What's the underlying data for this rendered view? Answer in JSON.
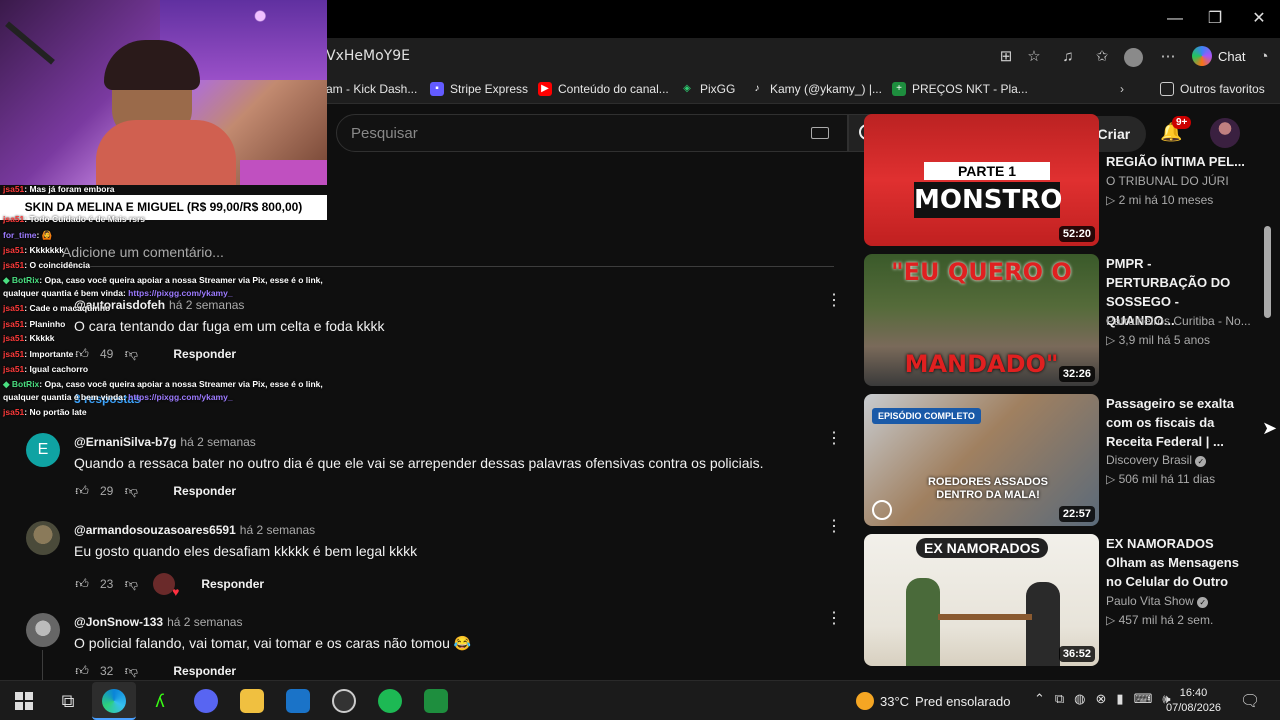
{
  "browser": {
    "url": "VxHeMoY9E",
    "chat_label": "Chat",
    "bookmarks": [
      {
        "label": "am - Kick Dash..."
      },
      {
        "label": "Stripe Express"
      },
      {
        "label": "Conteúdo do canal..."
      },
      {
        "label": "PixGG"
      },
      {
        "label": "Kamy (@ykamy_) |..."
      },
      {
        "label": "PREÇOS NKT - Pla..."
      }
    ],
    "other_favorites": "Outros favoritos"
  },
  "youtube": {
    "search_placeholder": "Pesquisar",
    "create_label": "Criar",
    "notif_badge": "9+",
    "add_comment": "Adicione um comentário...",
    "replies_label": "3 respostas",
    "reply_label": "Responder",
    "comments": [
      {
        "handle": "@autoraisdofeh",
        "time": "há 2 semanas",
        "text": "O cara tentando dar fuga em um celta e foda kkkk",
        "likes": "49"
      },
      {
        "handle": "@ErnaniSilva-b7g",
        "time": "há 2 semanas",
        "text": "Quando a ressaca bater no outro dia é que ele vai se arrepender dessas palavras ofensivas contra os policiais.",
        "likes": "29",
        "avatar_letter": "E"
      },
      {
        "handle": "@armandosouzasoares6591",
        "time": "há 2 semanas",
        "text": "Eu gosto quando eles desafiam kkkkk é bem legal kkkk",
        "likes": "23"
      },
      {
        "handle": "@JonSnow-133",
        "time": "há 2 semanas",
        "text": "O policial falando, vai tomar, vai tomar e os caras não tomou 😂",
        "likes": "32"
      }
    ],
    "videos": [
      {
        "title": "REGIÃO ÍNTIMA PEL...",
        "channel": "O TRIBUNAL DO JÚRI",
        "meta": "▷ 2 mi  há 10 meses",
        "duration": "52:20",
        "thumb_text": "PARTE 1\nMONSTRO"
      },
      {
        "title": "PMPR - PERTURBAÇÃO DO SOSSEGO - QUANDO...",
        "channel": "Patrulheiros Curitiba - No...",
        "meta": "▷ 3,9 mil  há 5 anos",
        "duration": "32:26",
        "thumb_text_top": "\"EU QUERO O",
        "thumb_text_bottom": "MANDADO\""
      },
      {
        "title": "Passageiro se exalta com os fiscais da Receita Federal | ...",
        "channel": "Discovery Brasil",
        "meta": "▷ 506 mil  há 11 dias",
        "duration": "22:57",
        "badge": "EPISÓDIO COMPLETO",
        "thumb_caption": "ROEDORES ASSADOS DENTRO DA MALA!"
      },
      {
        "title": "EX NAMORADOS Olham as Mensagens no Celular do Outro",
        "channel": "Paulo Vita Show",
        "meta": "▷ 457 mil  há 2 sem.",
        "duration": "36:52",
        "thumb_text": "EX NAMORADOS"
      }
    ]
  },
  "stream_overlay": {
    "skin_banner": "SKIN DA MELINA E MIGUEL (R$ 99,00/R$ 800,00)",
    "chat": [
      {
        "user": "jsa51",
        "msg": ": Mas já foram embora"
      },
      {
        "user": "jsa51",
        "msg": ": Todo Cuidado é de Mais rsrs"
      },
      {
        "user": "for_time",
        "msg": ": 🙆"
      },
      {
        "user": "jsa51",
        "msg": ": Kkkkkkk"
      },
      {
        "user": "jsa51",
        "msg": ": O coincidência"
      },
      {
        "user": "BotRix",
        "msg": ": Opa, caso você queira apoiar a nossa Streamer via Pix, esse é o link,"
      },
      {
        "user": "",
        "msg": "qualquer quantia é bem vinda: ",
        "link": "https://pixgg.com/ykamy_"
      },
      {
        "user": "jsa51",
        "msg": ": Cade o macaquinho"
      },
      {
        "user": "jsa51",
        "msg": ": Planinho"
      },
      {
        "user": "jsa51",
        "msg": ": Kkkkk"
      },
      {
        "user": "jsa51",
        "msg": ": Importante"
      },
      {
        "user": "jsa51",
        "msg": ": Igual cachorro"
      },
      {
        "user": "BotRix",
        "msg": ": Opa, caso você queira apoiar a nossa Streamer via Pix, esse é o link,"
      },
      {
        "user": "",
        "msg": "qualquer quantia é bem vinda: ",
        "link": "https://pixgg.com/ykamy_"
      },
      {
        "user": "jsa51",
        "msg": ": No portão late"
      }
    ]
  },
  "taskbar": {
    "temp": "33°C",
    "weather": "Pred ensolarado",
    "time": "16:40",
    "date": "07/08/2026"
  }
}
